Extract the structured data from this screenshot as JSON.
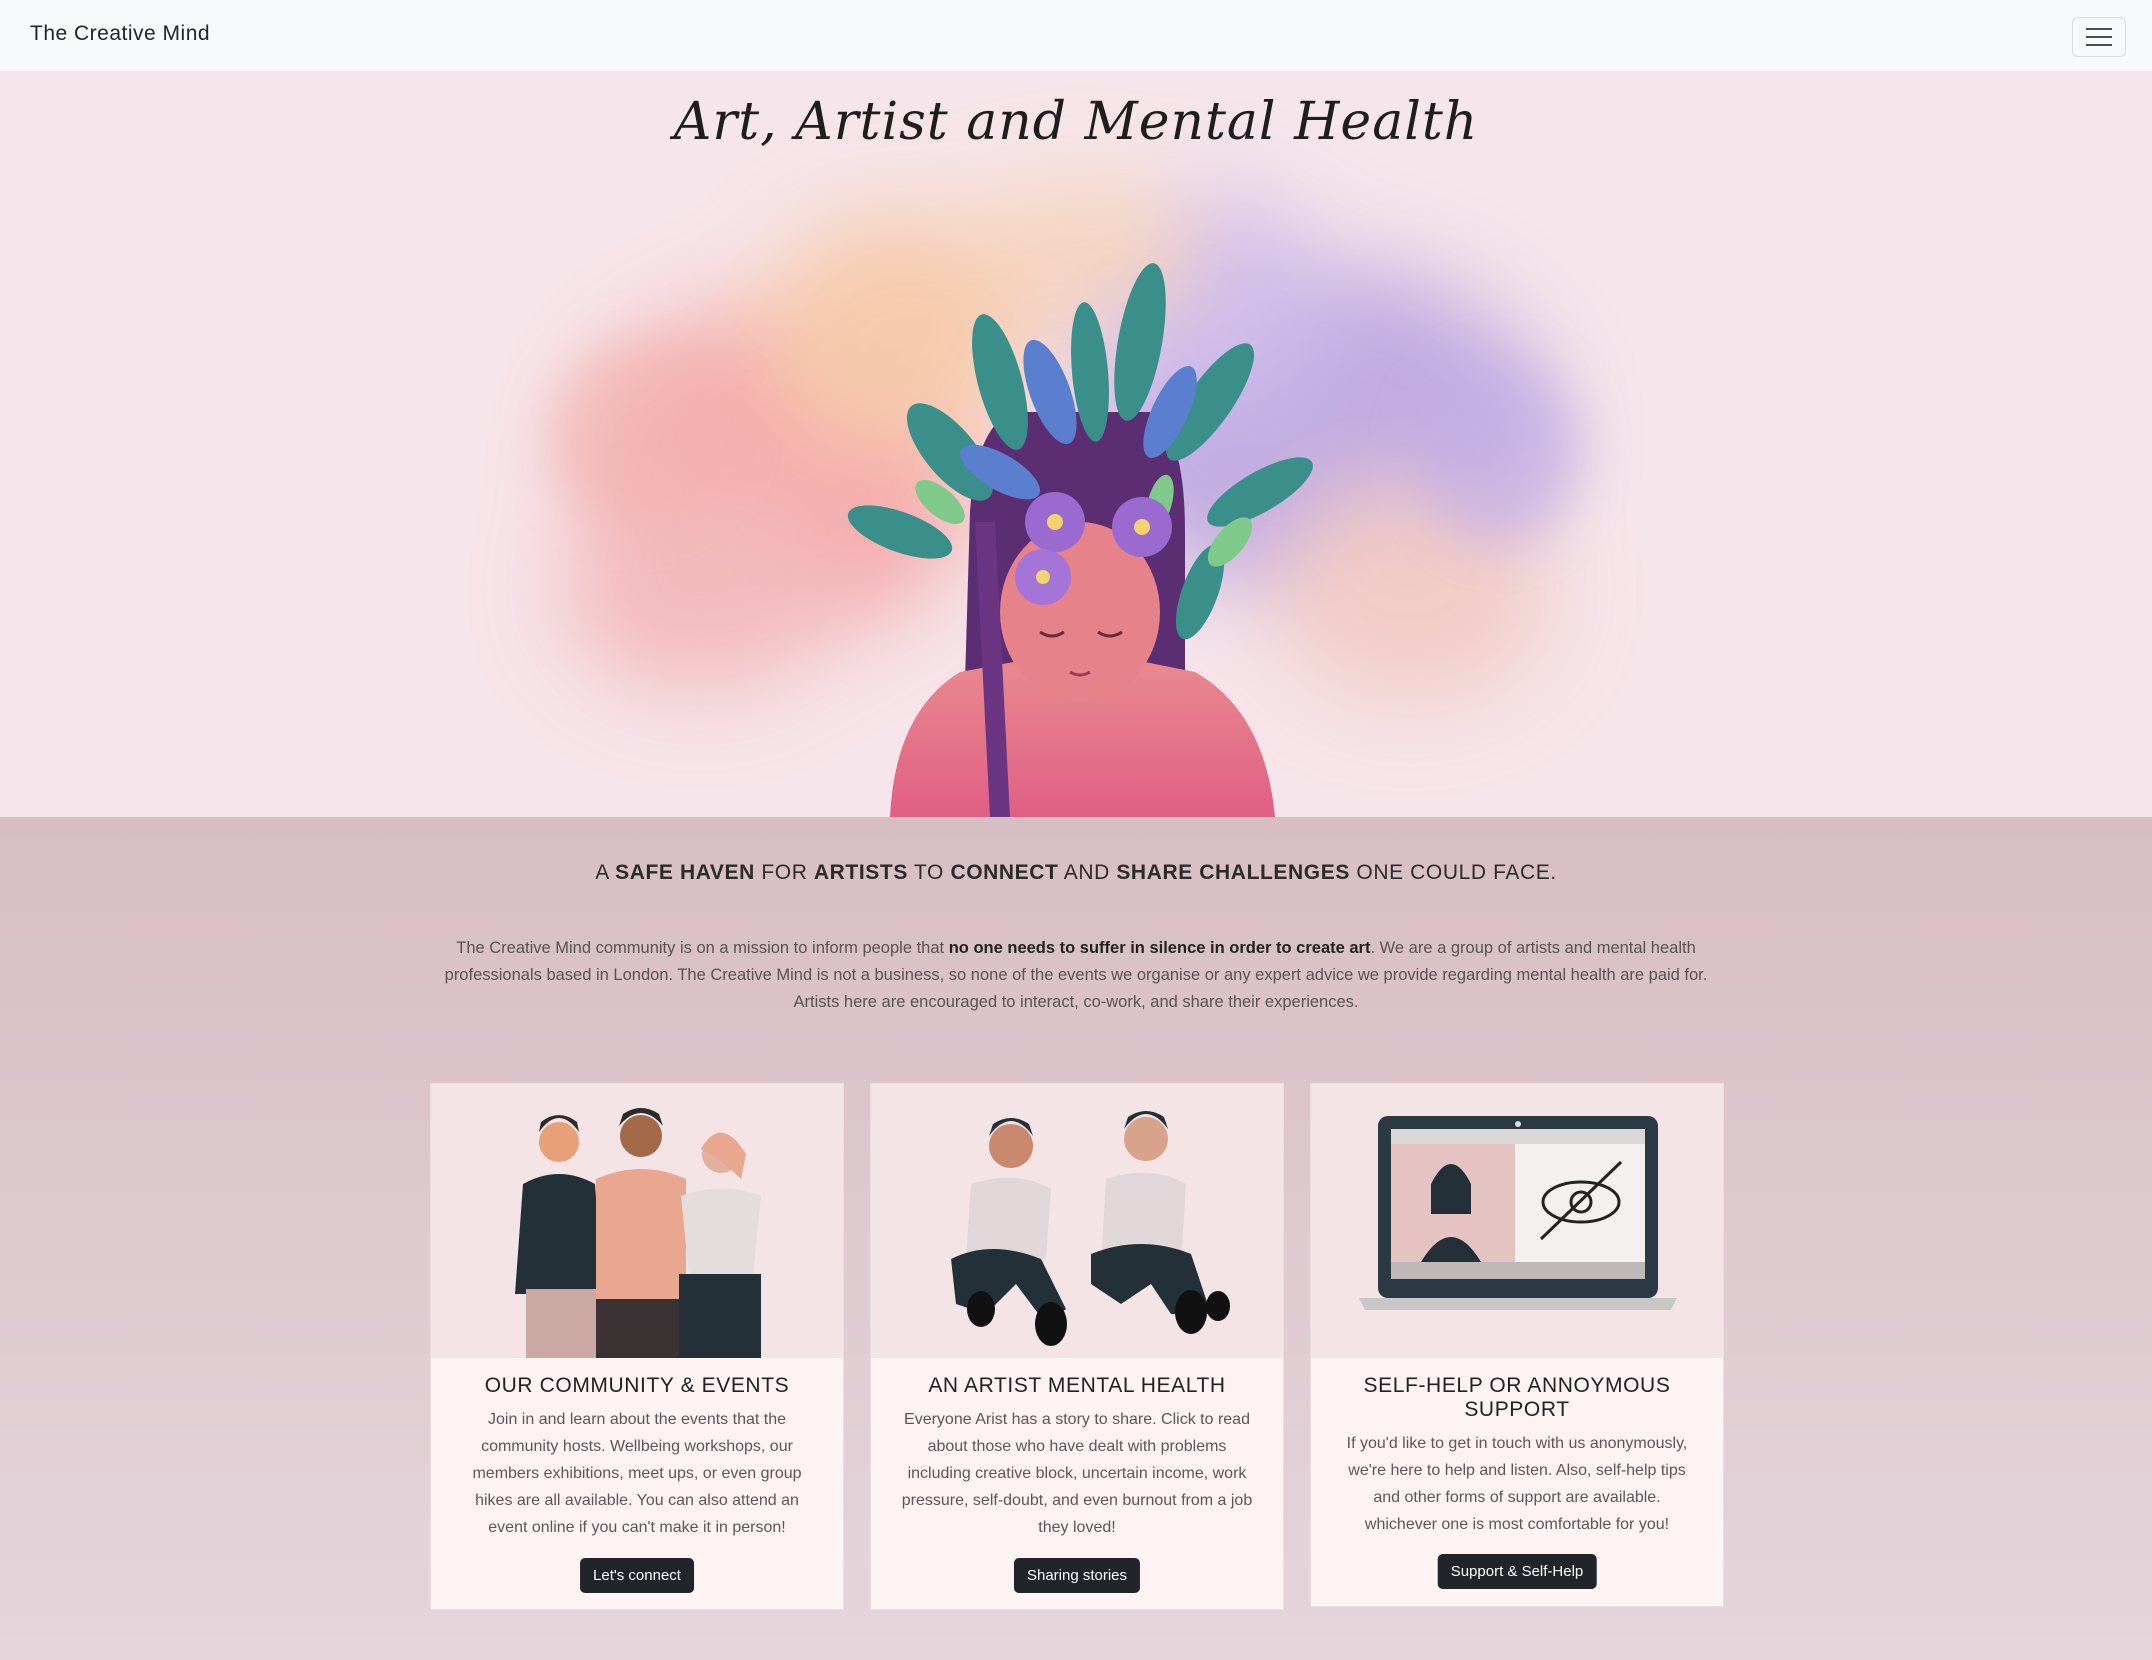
{
  "navbar": {
    "brand": "The Creative Mind",
    "toggle_icon": "hamburger-menu-icon"
  },
  "hero": {
    "title": "Art, Artist and Mental Health",
    "image": "watercolor-woman-with-plants-illustration"
  },
  "tagline": {
    "p1": "A ",
    "b1": "SAFE HAVEN",
    "p2": " FOR ",
    "b2": "ARTISTS",
    "p3": " TO ",
    "b3": "CONNECT",
    "p4": " AND ",
    "b4": "SHARE CHALLENGES",
    "p5": " ONE COULD FACE."
  },
  "mission": {
    "before": "The Creative Mind community is on a mission to inform people that ",
    "bold": "no one needs to suffer in silence in order to create art",
    "after": ". We are a group of artists and mental health professionals based in London. The Creative Mind is not a business, so none of the events we organise or any expert advice we provide regarding mental health are paid for. Artists here are encouraged to interact, co-work, and share their experiences."
  },
  "cards": [
    {
      "title": "OUR COMMUNITY & EVENTS",
      "text": "Join in and learn about the events that the community hosts. Wellbeing workshops, our members exhibitions, meet ups, or even group hikes are all available. You can also attend an event online if you can't make it in person!",
      "button": "Let's connect",
      "image": "three-friends-illustration"
    },
    {
      "title": "AN ARTIST MENTAL HEALTH",
      "text": "Everyone Arist has a story to share. Click to read about those who have dealt with problems including creative block, uncertain income, work pressure, self-doubt, and even burnout from a job they loved!",
      "button": "Sharing stories",
      "image": "two-men-talking-illustration"
    },
    {
      "title": "SELF-HELP OR ANNOYMOUS SUPPORT",
      "text": "If you'd like to get in touch with us anonymously, we're here to help and listen. Also, self-help tips and other forms of support are available. whichever one is most comfortable for you!",
      "button": "Support & Self-Help",
      "image": "laptop-video-call-illustration"
    }
  ],
  "colors": {
    "hero_bg": "#f6e5ea",
    "content_bg": "#d7bec2",
    "card_bg": "#fdf3f3",
    "button_bg": "#212529"
  }
}
